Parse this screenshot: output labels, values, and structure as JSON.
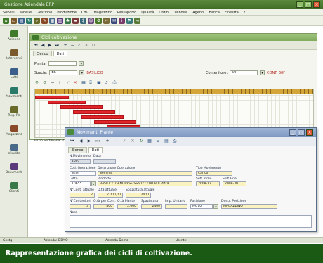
{
  "window": {
    "title": "Gestione Aziendale ERP"
  },
  "menu": [
    "Servizi",
    "Tabelle",
    "Gestione",
    "Produzione",
    "CdG",
    "Magazzino",
    "Passaporto",
    "Qualità",
    "Ordini",
    "Vendite",
    "Agenti",
    "Banca",
    "Finestra",
    "?"
  ],
  "sidebar": [
    {
      "label": "Aziende",
      "color": "#3f7a2a"
    },
    {
      "label": "Interventi",
      "color": "#7a5a2a"
    },
    {
      "label": "Lotti",
      "color": "#3a5f8a"
    },
    {
      "label": "Movimenti",
      "color": "#2a7a6a"
    },
    {
      "label": "Reg. PV",
      "color": "#6a6a2a"
    },
    {
      "label": "Magazzino",
      "color": "#8a4a2a"
    },
    {
      "label": "Vendite",
      "color": "#4a6a8a"
    },
    {
      "label": "Documenti",
      "color": "#5a3a7a"
    },
    {
      "label": "Clienti",
      "color": "#3a7a4a"
    }
  ],
  "cicli_window": {
    "title": "Cicli coltivazione",
    "tabs": [
      "Elenco",
      "Dati"
    ],
    "pianta_label": "Pianta:",
    "pianta_value": "",
    "specie_label": "Specie:",
    "specie_value": "BS",
    "specie_desc": "BASILICO",
    "contenitore_label": "Contenitore:",
    "contenitore_value": "60",
    "contenitore_desc": "CONT. 60F",
    "footer_label": "Inizio Settimana: 23",
    "gantt_rows": [
      {
        "label": "",
        "start": 0,
        "len": 8
      },
      {
        "label": "",
        "start": 3,
        "len": 9
      },
      {
        "label": "",
        "start": 6,
        "len": 10
      },
      {
        "label": "",
        "start": 9,
        "len": 10
      },
      {
        "label": "",
        "start": 11,
        "len": 10
      },
      {
        "label": "",
        "start": 14,
        "len": 10
      },
      {
        "label": "",
        "start": 17,
        "len": 8
      },
      {
        "label": "",
        "start": 20,
        "len": 8
      }
    ]
  },
  "dialog": {
    "title": "Movimenti Piante",
    "tabs": [
      "Elenco",
      "Dati"
    ],
    "n_movimento_label": "N.Movimento",
    "n_movimento_value": "2007",
    "data_label": "Data",
    "data_value": "",
    "cod_operazione_label": "Cod. Operazione",
    "cod_operazione_value": "SEMI",
    "descr_operazione_label": "Descrizione Operazione",
    "descr_operazione_value": "Semina",
    "tipo_movimento_label": "Tipo Movimento",
    "tipo_movimento_value": "Carico",
    "lotto_label": "Lotto",
    "lotto_value": "10655",
    "prodotto_label": "Prodotto",
    "prodotto_value": "BASILICO GENOVESE SS602 CONT.POL.440F",
    "sett_inizio_label": "Sett.Inizio",
    "sett_inizio_value": "2008-17",
    "sett_fine_label": "Sett.Fine",
    "sett_fine_value": "2008-30",
    "cont_attuale_label": "N°Cont. attuale",
    "cont_attuale_value": "2",
    "qta_attuale_label": "Q.tà attuale",
    "qta_attuale_value": "2.000,00",
    "spaziatura_attuale_label": "Spaziatura attuale",
    "spaziatura_attuale_value": "2400",
    "n_contenitori_label": "N°Contenitori",
    "n_contenitori_value": "3",
    "qta_cont_label": "Q.tà per Cont.",
    "qta_cont_value": "400",
    "qta_piante_label": "Q.tà Piante",
    "qta_piante_value": "2.000",
    "spaziatura_label": "Spaziatura",
    "spaziatura_value": "2400",
    "imp_unitario_label": "Imp. Unitario",
    "imp_unitario_value": "",
    "posizione_label": "Posizione",
    "posizione_value": "MG10",
    "descr_posizione_label": "Descr. Posizione",
    "descr_posizione_value": "MAGAZZINO",
    "note_label": "Note"
  },
  "statusbar": {
    "left": "Gestg",
    "azienda_label": "Azienda: DEMO",
    "azienda_name": "Azienda Demo",
    "utente": "Utente:"
  },
  "caption": "Rappresentazione grafica dei cicli di coltivazione.",
  "colors": {
    "gantt_bar": "#e0242a",
    "gantt_header": "#d4a63a",
    "caption_bg": "#1a5a14",
    "highlight_field": "#fbf3bf"
  }
}
